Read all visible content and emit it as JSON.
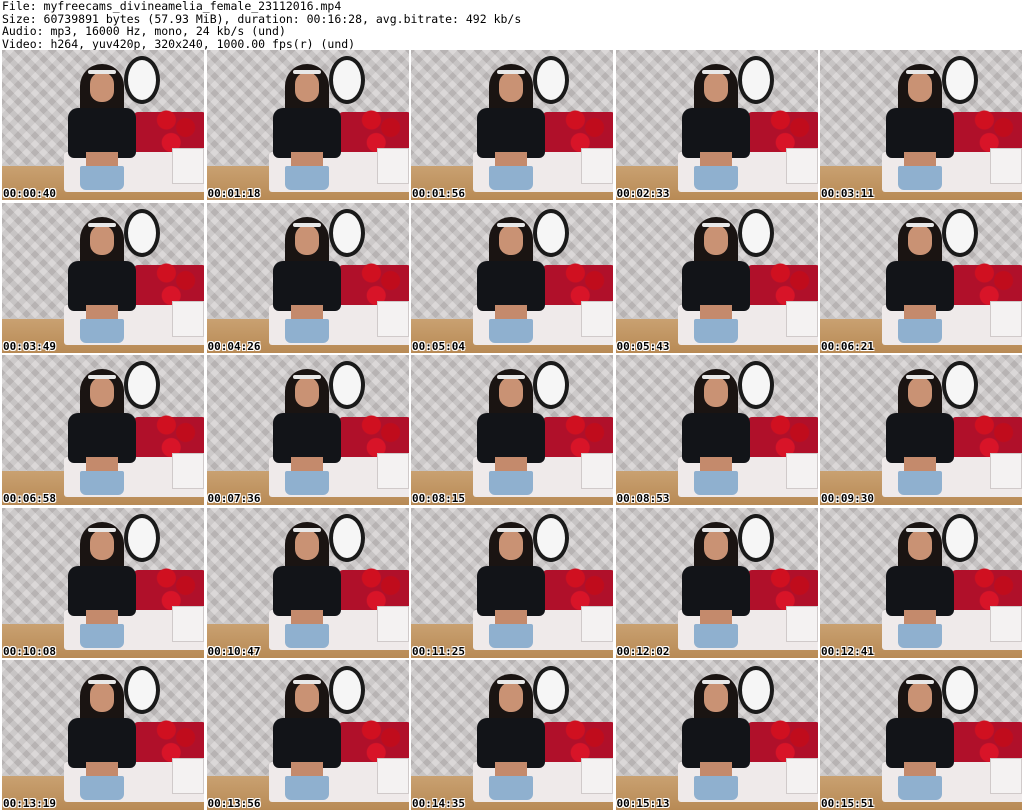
{
  "header": {
    "file_line": "File: myfreecams_divineamelia_female_23112016.mp4",
    "size_line": "Size: 60739891 bytes (57.93 MiB), duration: 00:16:28, avg.bitrate: 492 kb/s",
    "audio_line": "Audio: mp3, 16000 Hz, mono, 24 kb/s (und)",
    "video_line": "Video: h264, yuv420p, 320x240, 1000.00 fps(r) (und)"
  },
  "thumbnails": [
    {
      "timestamp": "00:00:40"
    },
    {
      "timestamp": "00:01:18"
    },
    {
      "timestamp": "00:01:56"
    },
    {
      "timestamp": "00:02:33"
    },
    {
      "timestamp": "00:03:11"
    },
    {
      "timestamp": "00:03:49"
    },
    {
      "timestamp": "00:04:26"
    },
    {
      "timestamp": "00:05:04"
    },
    {
      "timestamp": "00:05:43"
    },
    {
      "timestamp": "00:06:21"
    },
    {
      "timestamp": "00:06:58"
    },
    {
      "timestamp": "00:07:36"
    },
    {
      "timestamp": "00:08:15"
    },
    {
      "timestamp": "00:08:53"
    },
    {
      "timestamp": "00:09:30"
    },
    {
      "timestamp": "00:10:08"
    },
    {
      "timestamp": "00:10:47"
    },
    {
      "timestamp": "00:11:25"
    },
    {
      "timestamp": "00:12:02"
    },
    {
      "timestamp": "00:12:41"
    },
    {
      "timestamp": "00:13:19"
    },
    {
      "timestamp": "00:13:56"
    },
    {
      "timestamp": "00:14:35"
    },
    {
      "timestamp": "00:15:13"
    },
    {
      "timestamp": "00:15:51"
    }
  ]
}
